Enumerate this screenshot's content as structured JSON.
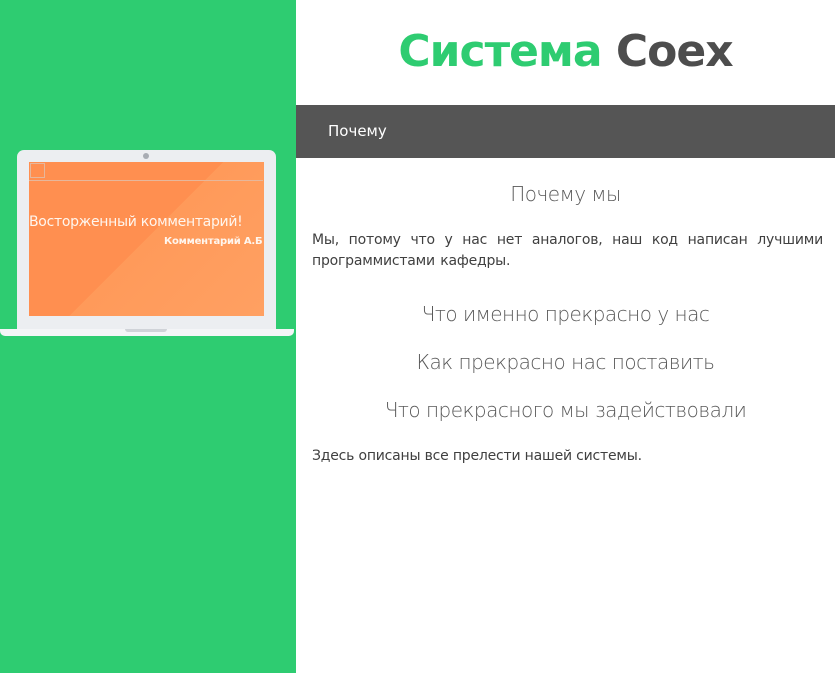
{
  "header": {
    "title_part1": "Система",
    "title_part2": "Coex"
  },
  "nav": {
    "items": [
      {
        "label": "Почему"
      }
    ]
  },
  "hero": {
    "quote": "Восторженный комментарий!",
    "author": "Комментарий А.Б"
  },
  "main": {
    "sections": [
      {
        "heading": "Почему мы"
      },
      {
        "heading": "Что именно прекрасно у нас"
      },
      {
        "heading": "Как прекрасно нас поставить"
      },
      {
        "heading": "Что прекрасного мы задействовали"
      }
    ],
    "paragraphs": [
      "Мы, потому что у нас нет аналогов, наш код написан лучшими программистами кафедры.",
      "Здесь описаны все прелести нашей системы."
    ]
  },
  "colors": {
    "accent_green": "#2ecc71",
    "nav_gray": "#555555",
    "screen_orange": "#ff8f50"
  }
}
